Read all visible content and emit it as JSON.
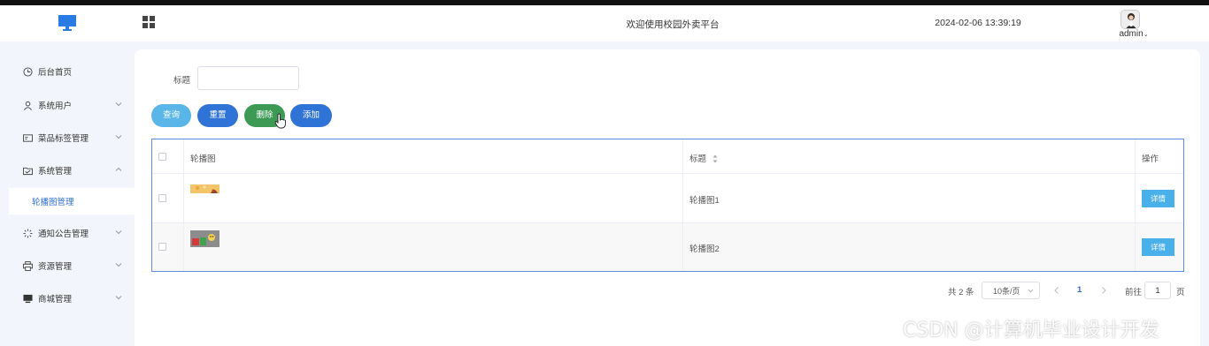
{
  "header": {
    "title": "欢迎使用校园外卖平台",
    "datetime": "2024-02-06 13:39:19",
    "user": "admin"
  },
  "sidebar": {
    "items": [
      {
        "label": "后台首页",
        "icon": "clock-icon"
      },
      {
        "label": "系统用户",
        "icon": "user-icon"
      },
      {
        "label": "菜品标签管理",
        "icon": "id-card-icon"
      },
      {
        "label": "系统管理",
        "icon": "folder-icon"
      },
      {
        "label": "通知公告管理",
        "icon": "loading-icon"
      },
      {
        "label": "资源管理",
        "icon": "printer-icon"
      },
      {
        "label": "商城管理",
        "icon": "monitor-icon"
      }
    ],
    "active_sub": "轮播图管理"
  },
  "search": {
    "label": "标题",
    "value": "",
    "placeholder": ""
  },
  "buttons": {
    "query": "查询",
    "reset": "重置",
    "delete": "删除",
    "add": "添加"
  },
  "table": {
    "columns": [
      "轮播图",
      "标题",
      "操作"
    ],
    "rows": [
      {
        "title": "轮播图1",
        "action": "详情"
      },
      {
        "title": "轮播图2",
        "action": "详情"
      }
    ]
  },
  "pagination": {
    "total": "共 2 条",
    "page_size": "10条/页",
    "current": "1",
    "goto_label": "前往",
    "goto_value": "1",
    "page_suffix": "页"
  },
  "watermark": "CSDN @计算机毕业设计开发",
  "colors": {
    "primary": "#2f73d6",
    "query": "#5ab6e8",
    "delete": "#3c9a55",
    "detail": "#4ab0ea",
    "active_menu": "#2b6fd6"
  }
}
